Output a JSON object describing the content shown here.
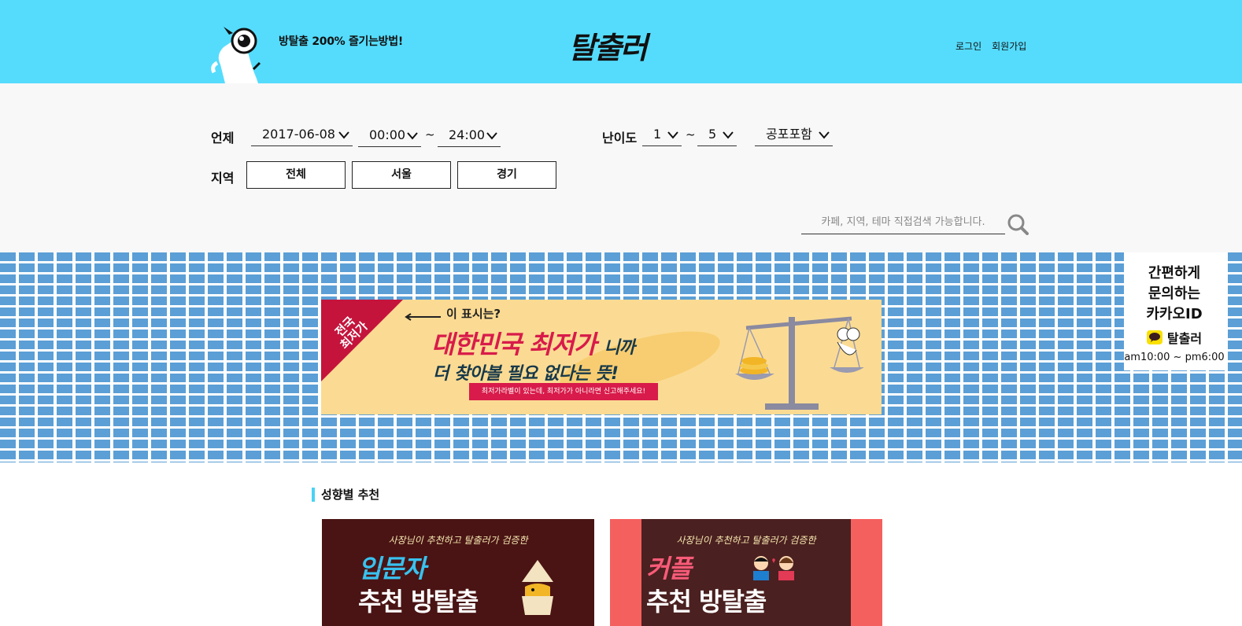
{
  "header": {
    "tagline": "방탈출 200% 즐기는방법!",
    "logo": "탈출러",
    "login": "로그인",
    "signup": "회원가입"
  },
  "filters": {
    "when_label": "언제",
    "date": "2017-06-08",
    "time_from": "00:00",
    "time_sep": "~",
    "time_to": "24:00",
    "difficulty_label": "난이도",
    "diff_from": "1",
    "diff_sep": "~",
    "diff_to": "5",
    "horror": "공포포함",
    "region_label": "지역",
    "regions": [
      "전체",
      "서울",
      "경기"
    ],
    "search_placeholder": "카페, 지역, 테마 직접검색 가능합니다."
  },
  "banner": {
    "corner_text_1": "전국",
    "corner_text_2": "최저가",
    "question": "이 표시는?",
    "headline": "대한민국 최저가",
    "headline_suffix": "니까",
    "subline": "더 찾아볼 필요 없다는 뜻!",
    "ribbon": "최저가라벨이 있는데, 최저가가 아니라면 신고해주세요!"
  },
  "kakao": {
    "line1": "간편하게",
    "line2": "문의하는",
    "line3": "카카오ID",
    "id": "탈출러",
    "hours": "am10:00 ~ pm6:00"
  },
  "section": {
    "title": "성향별 추천"
  },
  "cards": [
    {
      "sub": "사장님이 추천하고 탈출러가 검증한",
      "title": "입문자",
      "title2": "추천 방탈출"
    },
    {
      "sub": "사장님이 추천하고 탈출러가 검증한",
      "title": "커플",
      "title2": "추천 방탈출"
    }
  ],
  "colors": {
    "header_bg": "#55dcfd",
    "accent_red": "#d81b4a",
    "brick_blue": "#5b9fd6",
    "banner_bg": "#fbdb93"
  }
}
